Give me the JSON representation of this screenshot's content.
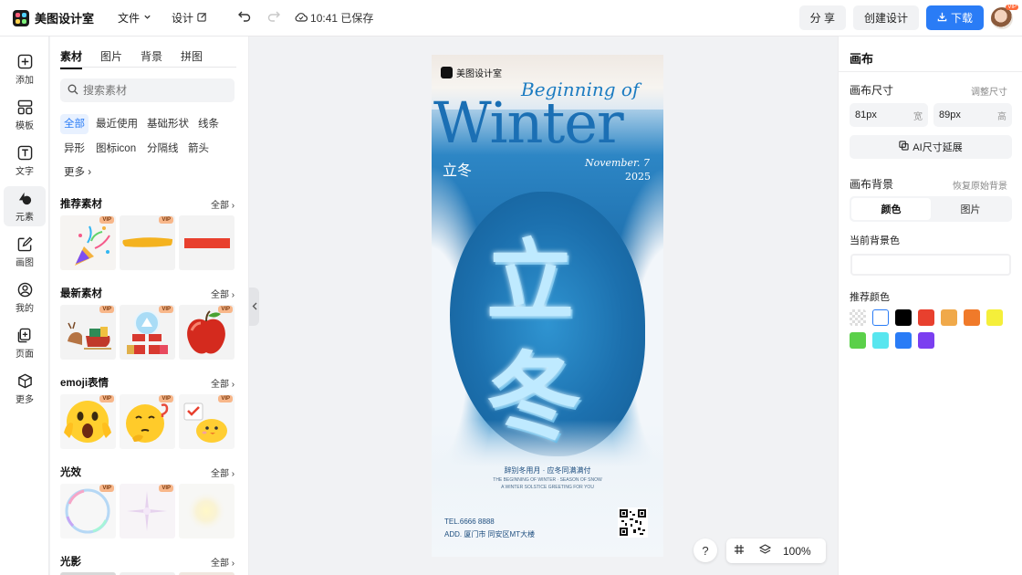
{
  "app": {
    "name": "美图设计室"
  },
  "menu": {
    "file": "文件",
    "design": "设计",
    "save_time": "10:41",
    "save_status": "已保存"
  },
  "toolbar": {
    "share": "分 享",
    "create_design": "创建设计",
    "download": "下载",
    "avatar_badge": "VIP"
  },
  "rail": [
    {
      "label": "添加",
      "icon": "plus-square-icon"
    },
    {
      "label": "模板",
      "icon": "template-icon"
    },
    {
      "label": "文字",
      "icon": "text-icon"
    },
    {
      "label": "元素",
      "icon": "elements-icon"
    },
    {
      "label": "画图",
      "icon": "draw-icon"
    },
    {
      "label": "我的",
      "icon": "user-icon"
    },
    {
      "label": "页面",
      "icon": "page-icon"
    },
    {
      "label": "更多",
      "icon": "more-cube-icon"
    }
  ],
  "assets": {
    "tabs": [
      "素材",
      "图片",
      "背景",
      "拼图"
    ],
    "search_placeholder": "搜索素材",
    "chips": [
      "全部",
      "最近使用",
      "基础形状",
      "线条",
      "异形",
      "图标icon",
      "分隔线",
      "箭头",
      "更多"
    ],
    "all_label": "全部",
    "vip_label": "VIP",
    "sections": [
      {
        "title": "推荐素材",
        "items": [
          "confetti-popper",
          "yellow-brush-stroke",
          "red-bar"
        ]
      },
      {
        "title": "最新素材",
        "items": [
          "reindeer-sleigh",
          "snow-globe-gift",
          "red-apple"
        ]
      },
      {
        "title": "emoji表情",
        "items": [
          "shocked-emoji",
          "thinking-emoji",
          "chick-emoji"
        ]
      },
      {
        "title": "光效",
        "items": [
          "bubble-ring",
          "sparkle-light",
          "glow-light"
        ]
      },
      {
        "title": "光影",
        "items": []
      }
    ]
  },
  "poster": {
    "brand": "美图设计室",
    "heading_small": "Beginning of",
    "heading_large": "Winter",
    "subtitle_cn": "立冬",
    "date_line1": "November. 7",
    "date_line2": "2025",
    "main_glyph_1": "立",
    "main_glyph_2": "冬",
    "tagline": "辞别冬用月 · 应冬同满满付",
    "tagline_small_1": "THE BEGINNING OF WINTER · SEASON OF SNOW",
    "tagline_small_2": "A WINTER SOLSTICE GREETING FOR YOU",
    "tel": "TEL.6666 8888",
    "address": "ADD. 厦门市 同安区MT大楼"
  },
  "zoom": {
    "value": "100%",
    "help": "?"
  },
  "canvas_panel": {
    "title": "画布",
    "size_label": "画布尺寸",
    "adjust_size": "调整尺寸",
    "width_value": "81px",
    "width_unit": "宽",
    "height_value": "89px",
    "height_unit": "高",
    "ai_extend": "AI尺寸延展",
    "bg_label": "画布背景",
    "restore_bg": "恢复原始背景",
    "bg_tabs": [
      "颜色",
      "图片"
    ],
    "current_bg_label": "当前背景色",
    "current_bg_color": "#ffffff",
    "recommended_label": "推荐颜色",
    "swatches": [
      "transparent",
      "#ffffff",
      "#000000",
      "#e8402e",
      "#f0a94a",
      "#f07a2a",
      "#f5ef3a",
      "#5bd04a",
      "#58e6ef",
      "#2a7cf6",
      "#7b3ff0"
    ]
  }
}
